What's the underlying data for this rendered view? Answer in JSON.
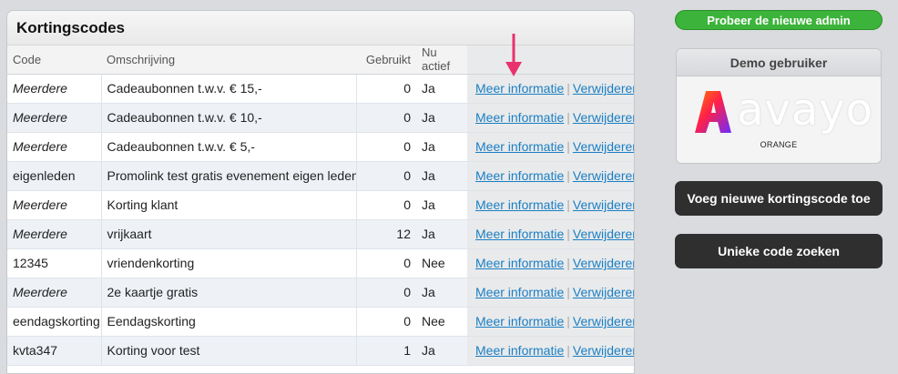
{
  "panel": {
    "title": "Kortingscodes",
    "columns": {
      "code": "Code",
      "description": "Omschrijving",
      "used": "Gebruikt",
      "active": "Nu actief"
    },
    "action_more": "Meer informatie",
    "action_delete": "Verwijderen",
    "separator": "|",
    "rows": [
      {
        "code": "Meerdere",
        "description": "Cadeaubonnen t.w.v. € 15,-",
        "used": "0",
        "active": "Ja"
      },
      {
        "code": "Meerdere",
        "description": "Cadeaubonnen t.w.v. € 10,-",
        "used": "0",
        "active": "Ja"
      },
      {
        "code": "Meerdere",
        "description": "Cadeaubonnen t.w.v. € 5,-",
        "used": "0",
        "active": "Ja"
      },
      {
        "code": "eigenleden",
        "description": "Promolink test gratis evenement eigen leden",
        "used": "0",
        "active": "Ja"
      },
      {
        "code": "Meerdere",
        "description": "Korting klant",
        "used": "0",
        "active": "Ja"
      },
      {
        "code": "Meerdere",
        "description": "vrijkaart",
        "used": "12",
        "active": "Ja"
      },
      {
        "code": "12345",
        "description": "vriendenkorting",
        "used": "0",
        "active": "Nee"
      },
      {
        "code": "Meerdere",
        "description": "2e kaartje gratis",
        "used": "0",
        "active": "Ja"
      },
      {
        "code": "eendagskorting",
        "description": "Eendagskorting",
        "used": "0",
        "active": "Nee"
      },
      {
        "code": "kvta347",
        "description": "Korting voor test",
        "used": "1",
        "active": "Ja"
      }
    ]
  },
  "sidebar": {
    "new_admin_button": "Probeer de nieuwe admin",
    "demo_title": "Demo gebruiker",
    "logo_text": "avayo",
    "demo_subtitle": "ORANGE",
    "add_code_button": "Voeg nieuwe kortingscode toe",
    "search_code_button": "Unieke code zoeken"
  },
  "colors": {
    "link": "#1a7fc4",
    "green_button": "#3cb33a",
    "dark_button": "#2f2f2f",
    "arrow": "#e8326e"
  },
  "icons": {
    "annotation": "arrow-down-icon",
    "logo": "avayo-logo-icon"
  }
}
